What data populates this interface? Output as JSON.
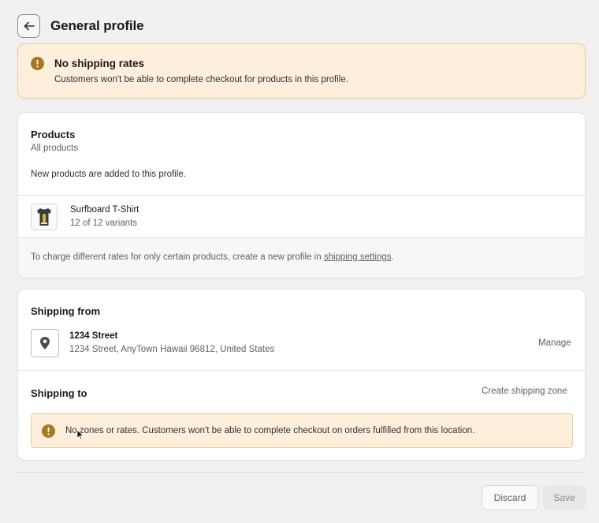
{
  "header": {
    "title": "General profile",
    "back_icon": "arrow-left-icon"
  },
  "banner": {
    "title": "No shipping rates",
    "text": "Customers won't be able to complete checkout for products in this profile.",
    "icon": "warning-icon",
    "color": "#a57a1f"
  },
  "products": {
    "title": "Products",
    "subtitle": "All products",
    "note": "New products are added to this profile.",
    "items": [
      {
        "name": "Surfboard T-Shirt",
        "variants": "12 of 12 variants"
      }
    ],
    "footer_text": "To charge different rates for only certain products, create a new profile in ",
    "footer_link": "shipping settings",
    "footer_end": "."
  },
  "shipping_from": {
    "title": "Shipping from",
    "location_name": "1234 Street",
    "location_address": "1234 Street, AnyTown Hawaii 96812, United States",
    "manage_label": "Manage",
    "icon": "location-pin-icon"
  },
  "shipping_to": {
    "title": "Shipping to",
    "create_label": "Create shipping zone",
    "warning_text": "No zones or rates. Customers won't be able to complete checkout on orders fulfilled from this location."
  },
  "actions": {
    "discard_label": "Discard",
    "save_label": "Save"
  }
}
